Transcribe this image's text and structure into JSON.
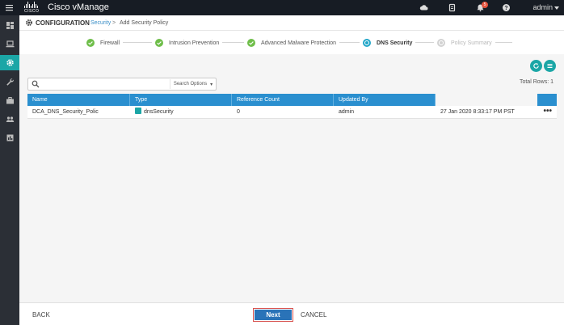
{
  "app": {
    "title": "Cisco vManage",
    "logo_text": "CISCO"
  },
  "topbar": {
    "user": "admin",
    "notification_count": "5"
  },
  "header": {
    "section": "CONFIGURATION",
    "breadcrumb_link": "Security",
    "breadcrumb_sep": ">",
    "breadcrumb_current": "Add Security Policy"
  },
  "steps": [
    {
      "label": "Firewall",
      "state": "done"
    },
    {
      "label": "Intrusion Prevention",
      "state": "done"
    },
    {
      "label": "Advanced Malware Protection",
      "state": "done"
    },
    {
      "label": "DNS Security",
      "state": "current"
    },
    {
      "label": "Policy Summary",
      "state": "pending"
    }
  ],
  "search": {
    "placeholder": "",
    "options_label": "Search Options"
  },
  "total_rows": "Total Rows: 1",
  "table": {
    "columns": [
      "Name",
      "Type",
      "Reference Count",
      "Updated By",
      ""
    ],
    "rows": [
      {
        "name": "DCA_DNS_Security_Polic",
        "type": "dnsSecurity",
        "reference_count": "0",
        "updated_by": "admin",
        "updated": "27 Jan 2020 8:33:17 PM PST"
      }
    ]
  },
  "footer": {
    "back": "BACK",
    "next": "Next",
    "cancel": "CANCEL"
  },
  "colors": {
    "topbar": "#171c24",
    "sidebar": "#2b2f36",
    "accent": "#1ba6a6",
    "table_header": "#2a8fcf",
    "next_button": "#2a73b8"
  }
}
